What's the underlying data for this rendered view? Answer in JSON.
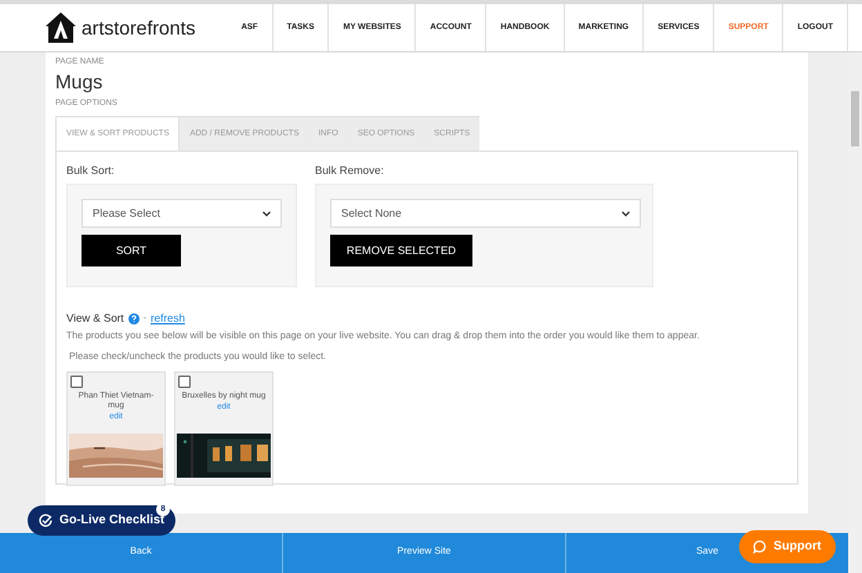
{
  "header": {
    "brand": "artstorefronts",
    "nav": [
      {
        "label": "ASF",
        "selected": false
      },
      {
        "label": "TASKS",
        "selected": false
      },
      {
        "label": "MY WEBSITES",
        "selected": false
      },
      {
        "label": "ACCOUNT",
        "selected": false
      },
      {
        "label": "HANDBOOK",
        "selected": false
      },
      {
        "label": "MARKETING",
        "selected": false
      },
      {
        "label": "SERVICES",
        "selected": false
      },
      {
        "label": "SUPPORT",
        "selected": true
      },
      {
        "label": "LOGOUT",
        "selected": false
      }
    ]
  },
  "page": {
    "name_label": "PAGE NAME",
    "name": "Mugs",
    "options_label": "PAGE OPTIONS"
  },
  "tabs": [
    {
      "label": "VIEW & SORT PRODUCTS",
      "selected": true
    },
    {
      "label": "ADD / REMOVE PRODUCTS",
      "selected": false
    },
    {
      "label": "INFO",
      "selected": false
    },
    {
      "label": "SEO OPTIONS",
      "selected": false
    },
    {
      "label": "SCRIPTS",
      "selected": false
    }
  ],
  "bulk_sort": {
    "label": "Bulk Sort:",
    "select": "Please Select",
    "button": "SORT"
  },
  "bulk_remove": {
    "label": "Bulk Remove:",
    "select": "Select None",
    "button": "REMOVE SELECTED"
  },
  "view_sort": {
    "title": "View & Sort",
    "separator": "-",
    "link": "refresh",
    "description": "The products you see below will be visible on this page on your live website. You can drag & drop them into the order you would like them to appear.",
    "instruction": "Please check/uncheck the products you would like to select."
  },
  "products": [
    {
      "name": "Phan Thiet Vietnam-mug",
      "edit": "edit",
      "checked": false,
      "kind": "desert"
    },
    {
      "name": "Bruxelles by night mug",
      "edit": "edit",
      "checked": false,
      "kind": "night"
    }
  ],
  "footer": {
    "buttons": [
      "Back",
      "Preview Site",
      "Save"
    ]
  },
  "checklist": {
    "label": "Go-Live Checklist",
    "count": "8"
  },
  "support": {
    "label": "Support"
  }
}
